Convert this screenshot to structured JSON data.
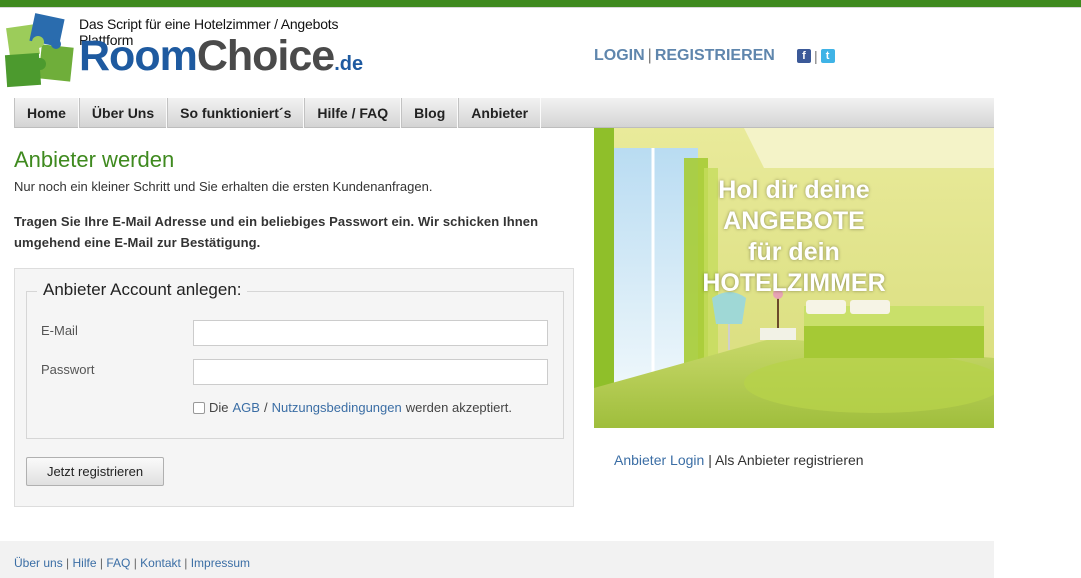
{
  "header": {
    "tagline": "Das Script für eine Hotelzimmer / Angebots Plattform",
    "brand_room": "Room",
    "brand_choice": "Choice",
    "brand_tld": ".de",
    "login_label": "LOGIN",
    "register_label": "REGISTRIEREN",
    "separator": "|",
    "social": [
      {
        "icon": "facebook-icon",
        "glyph": "f"
      },
      {
        "icon": "twitter-icon",
        "glyph": "t"
      }
    ]
  },
  "nav": {
    "items": [
      "Home",
      "Über Uns",
      "So funktioniert´s",
      "Hilfe / FAQ",
      "Blog",
      "Anbieter"
    ]
  },
  "main": {
    "title": "Anbieter werden",
    "subtitle": "Nur noch ein kleiner Schritt und Sie erhalten die ersten Kundenanfragen.",
    "instructions": "Tragen Sie Ihre E-Mail Adresse und ein beliebiges Passwort ein. Wir schicken Ihnen umgehend eine E-Mail zur Bestätigung."
  },
  "form": {
    "legend": "Anbieter Account anlegen:",
    "email_label": "E-Mail",
    "email_value": "",
    "password_label": "Passwort",
    "password_value": "",
    "agree_prefix": "Die",
    "agb_link": "AGB",
    "agree_slash": "/",
    "terms_link": "Nutzungsbedingungen",
    "agree_suffix": "werden akzeptiert.",
    "agree_checked": false,
    "submit_label": "Jetzt registrieren"
  },
  "promo": {
    "line1": "Hol dir deine",
    "line2": "ANGEBOTE",
    "line3": "für dein",
    "line4": "HOTELZIMMER"
  },
  "side_links": {
    "login": "Anbieter Login",
    "separator": "|",
    "register": "Als Anbieter registrieren"
  },
  "footer": {
    "links": [
      "Über uns",
      "Hilfe",
      "FAQ",
      "Kontakt",
      "Impressum"
    ],
    "separator": "|"
  },
  "colors": {
    "accent_green": "#3f8a1f",
    "brand_blue": "#1e5aa0",
    "link_blue": "#3b6ea5"
  }
}
